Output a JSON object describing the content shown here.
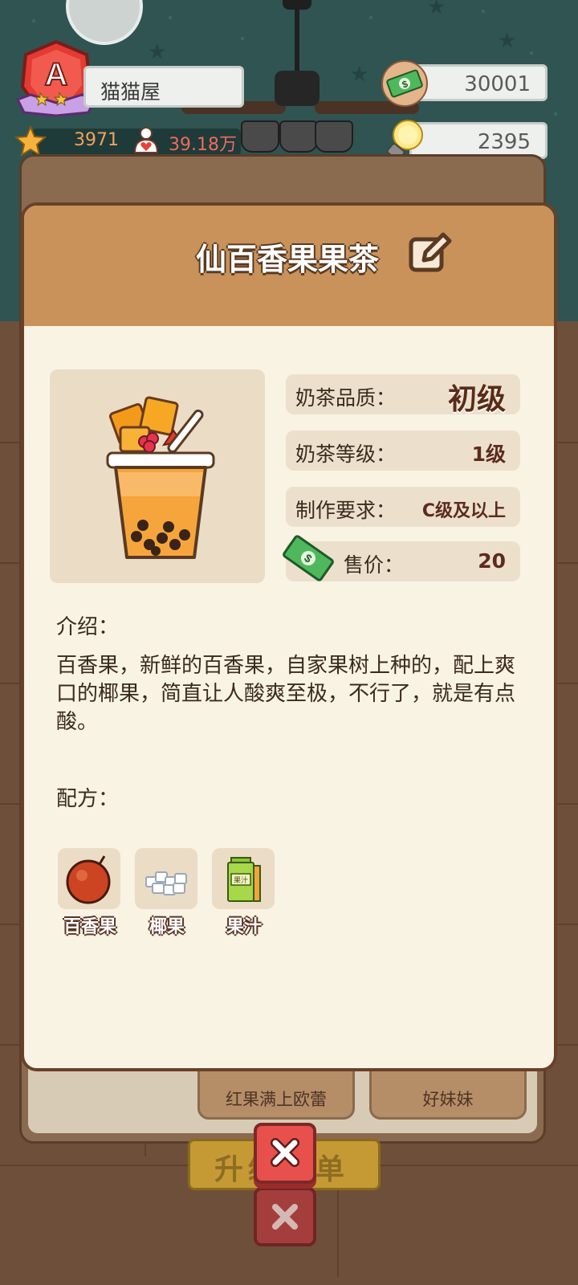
{
  "hud": {
    "shop_name": "猫猫屋",
    "rank_letter": "A",
    "stars": "3971",
    "fans": "39.18万",
    "cash": "30001",
    "ideas": "2395"
  },
  "background": {
    "cards": [
      "红果满上欧蕾",
      "好妹妹"
    ],
    "button_label": "升级菜单"
  },
  "modal": {
    "title": "仙百香果果茶",
    "info": {
      "quality_label": "奶茶品质：",
      "quality_value": "初级",
      "level_label": "奶茶等级：",
      "level_value": "1级",
      "req_label": "制作要求：",
      "req_value": "C级及以上",
      "price_label": "售价：",
      "price_value": "20"
    },
    "intro_heading": "介绍：",
    "intro_text": "百香果，新鲜的百香果，自家果树上种的，配上爽口的椰果，简直让人酸爽至极，不行了，就是有点酸。",
    "recipe_heading": "配方：",
    "ingredients": [
      {
        "name": "百香果",
        "icon": "passion-fruit-icon"
      },
      {
        "name": "椰果",
        "icon": "coconut-jelly-icon"
      },
      {
        "name": "果汁",
        "icon": "juice-box-icon"
      }
    ],
    "juice_box_text": "果汁"
  },
  "colors": {
    "wall": "#2f5451",
    "modal_header": "#c8925a",
    "modal_body": "#f9f3e4",
    "close_button": "#e8504c"
  }
}
